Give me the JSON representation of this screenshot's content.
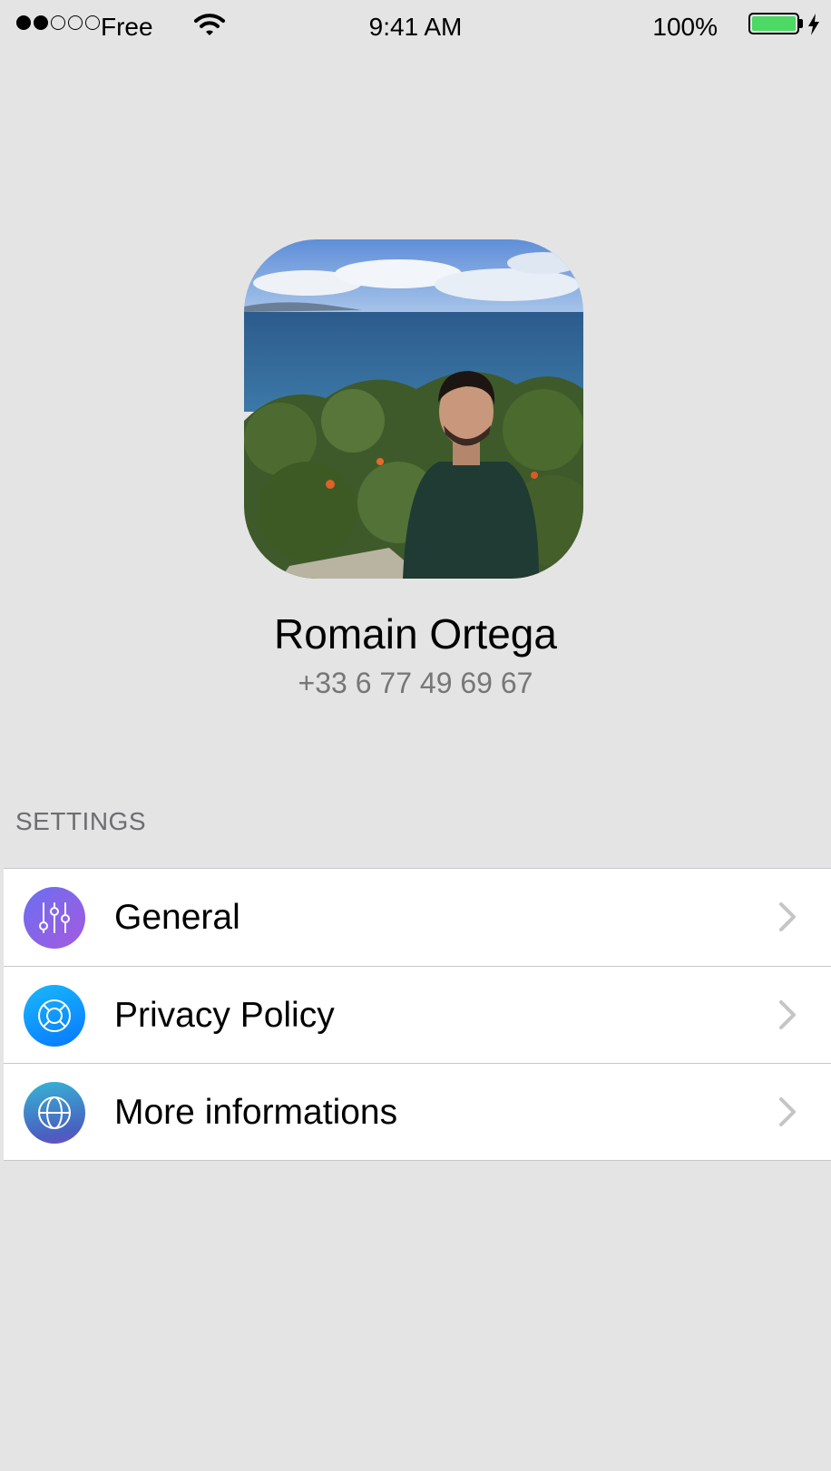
{
  "status_bar": {
    "carrier": "Free",
    "time": "9:41 AM",
    "battery": "100%"
  },
  "profile": {
    "name": "Romain Ortega",
    "phone": "+33 6 77 49 69 67"
  },
  "settings": {
    "header": "SETTINGS",
    "items": [
      {
        "label": "General",
        "icon": "sliders-icon"
      },
      {
        "label": "Privacy Policy",
        "icon": "lifebuoy-icon"
      },
      {
        "label": "More informations",
        "icon": "globe-icon"
      }
    ]
  }
}
